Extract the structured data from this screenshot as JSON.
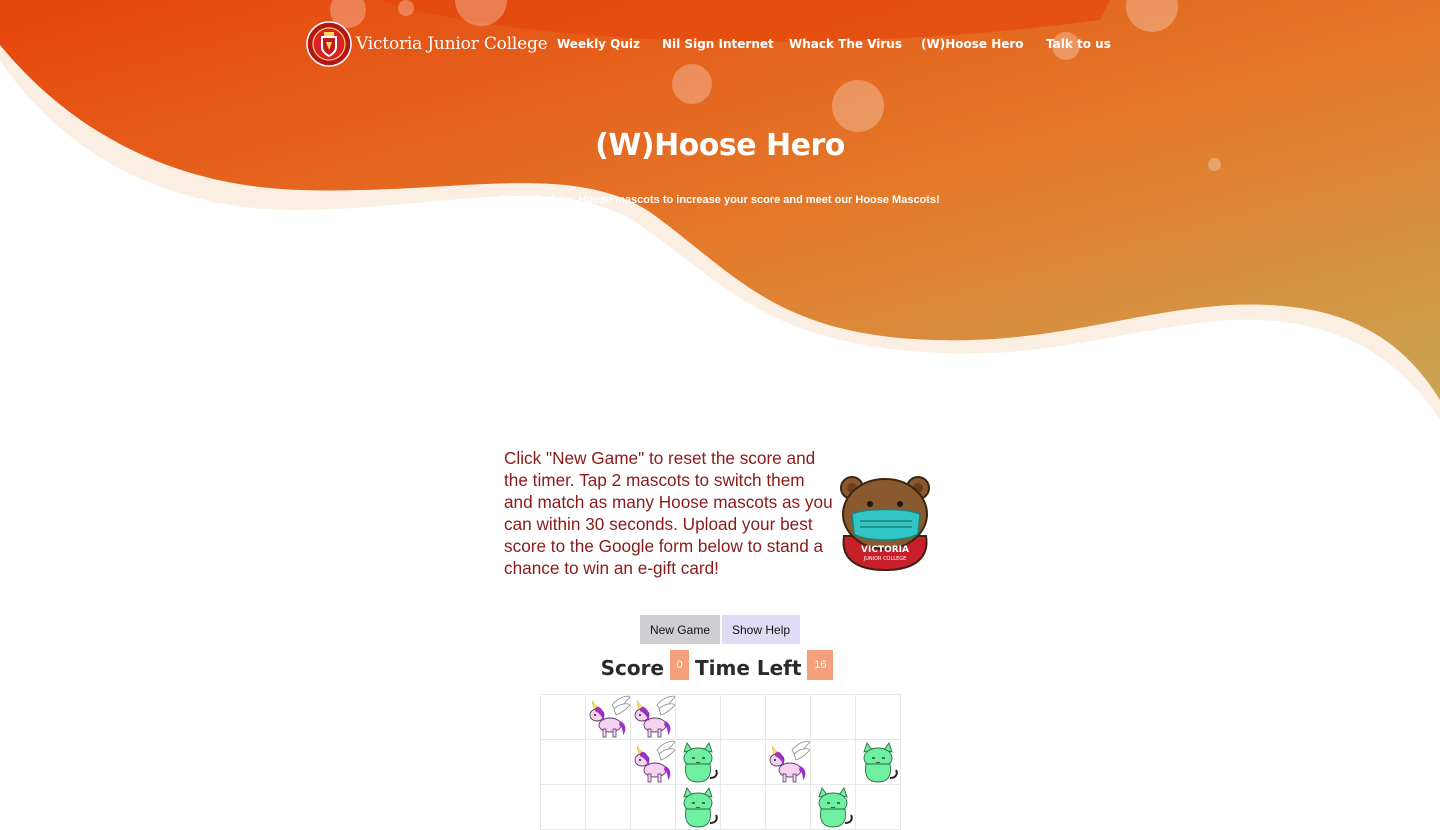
{
  "brand": {
    "name": "Victoria Junior College",
    "crest_icon": "school-crest-icon"
  },
  "nav": {
    "links": [
      {
        "label": "Weekly Quiz"
      },
      {
        "label": "Nil Sign Internet"
      },
      {
        "label": "Whack The Virus"
      },
      {
        "label": "(W)Hoose Hero"
      },
      {
        "label": "Talk to us"
      }
    ]
  },
  "hero": {
    "title": "(W)Hoose Hero",
    "subtitle": "Match 3 of our Hoose mascots to increase your score and meet our Hoose Mascots!"
  },
  "help": {
    "text": "Click \"New Game\" to reset the score and the timer. Tap 2 mascots to switch them and match as many Hoose mascots as you can within 30 seconds. Upload your best score to the Google form below to stand a chance to win an e-gift card!",
    "mascot_icon": "bear-mascot-icon",
    "mascot_shirt_text": "VICTORIA",
    "mascot_shirt_subtext": "JUNIOR COLLEGE"
  },
  "controls": {
    "new_game_label": "New Game",
    "show_help_label": "Show Help"
  },
  "status": {
    "score_label": "Score",
    "score_value": "0",
    "time_label": "Time Left",
    "time_value": "16"
  },
  "board": {
    "columns": 8,
    "rows": [
      [
        "empty",
        "unicorn",
        "unicorn",
        "empty",
        "empty",
        "empty",
        "empty",
        "empty"
      ],
      [
        "empty",
        "empty",
        "unicorn",
        "cat",
        "empty",
        "unicorn",
        "empty",
        "cat"
      ],
      [
        "empty",
        "empty",
        "empty",
        "cat",
        "empty",
        "empty",
        "cat",
        "empty"
      ]
    ]
  },
  "colors": {
    "hero_top": "#e8500e",
    "hero_bottom": "#c8a050",
    "accent_box": "#f4a07d",
    "help_text": "#8b1a1a",
    "unicorn_mane": "#9b30c8",
    "cat_body": "#6ef0a0"
  }
}
